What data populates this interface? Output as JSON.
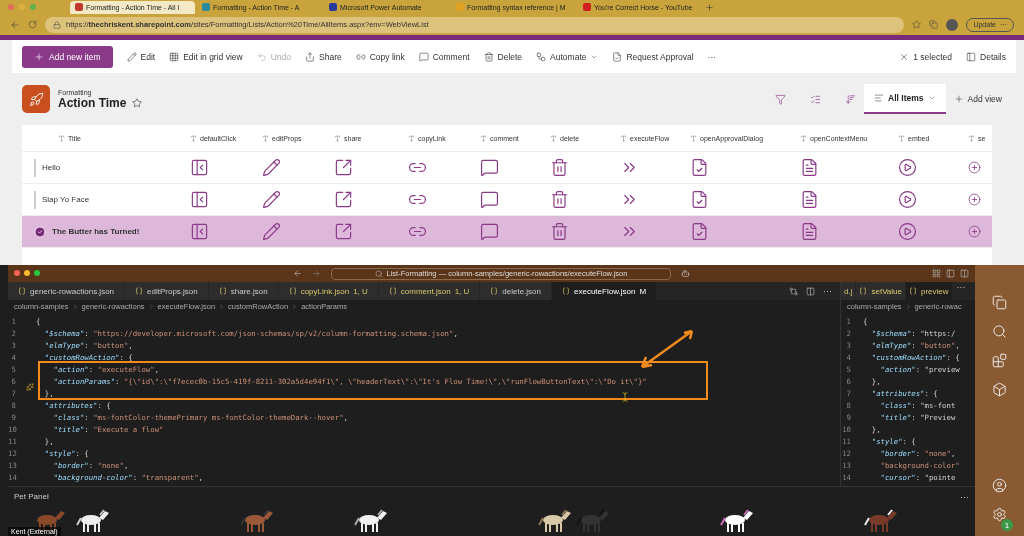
{
  "browser": {
    "tabs": [
      {
        "title": "Formatting - Action Time - All I",
        "selected": true
      },
      {
        "title": "Formatting - Action Time - A",
        "selected": false
      },
      {
        "title": "Microsoft Power Automate",
        "selected": false
      },
      {
        "title": "Formatting syntax reference | M",
        "selected": false
      },
      {
        "title": "You're Correct Horse - YouTube",
        "selected": false
      }
    ],
    "url": "https://**thechriskent.sharepoint.com**/sites/Formatting/Lists/Action%20Time/AllItems.aspx?env=WebViewList",
    "update_button": "Update",
    "update_more": "···"
  },
  "command_bar": {
    "primary": "Add new item",
    "items": [
      {
        "label": "Edit",
        "disabled": false
      },
      {
        "label": "Edit in grid view",
        "disabled": false
      },
      {
        "label": "Undo",
        "disabled": true
      },
      {
        "label": "Share",
        "disabled": false
      },
      {
        "label": "Copy link",
        "disabled": false
      },
      {
        "label": "Comment",
        "disabled": false
      },
      {
        "label": "Delete",
        "disabled": false
      },
      {
        "label": "Automate",
        "disabled": false
      },
      {
        "label": "Request Approval",
        "disabled": false
      }
    ],
    "more": "···",
    "selected_count": "1 selected",
    "details": "Details"
  },
  "list_header": {
    "site": "Formatting",
    "title": "Action Time",
    "views": [
      {
        "label": "All Items",
        "selected": true
      }
    ],
    "add_view": "Add view"
  },
  "table": {
    "columns": [
      "Title",
      "defaultClick",
      "editProps",
      "share",
      "copyLink",
      "comment",
      "delete",
      "executeFlow",
      "openApprovalDialog",
      "openContextMenu",
      "embed",
      "se"
    ],
    "rows": [
      {
        "title": "Hello",
        "selected": false
      },
      {
        "title": "Slap Yo Face",
        "selected": false
      },
      {
        "title": "The Butter has Turned!",
        "selected": true
      }
    ]
  },
  "editor": {
    "title": "List-Formatting — column-samples/generic-rowactions/executeFlow.json",
    "tabs": [
      {
        "label": "generic-rowactions.json",
        "untracked": false,
        "selected": false
      },
      {
        "label": "editProps.json",
        "untracked": false,
        "selected": false
      },
      {
        "label": "share.json",
        "untracked": false,
        "selected": false
      },
      {
        "label": "copyLink.json",
        "badge": "1, U",
        "untracked": true,
        "selected": false
      },
      {
        "label": "comment.json",
        "badge": "1, U",
        "untracked": true,
        "selected": false
      },
      {
        "label": "delete.json",
        "untracked": false,
        "selected": false
      },
      {
        "label": "executeFlow.json",
        "badge": "M",
        "untracked": false,
        "selected": true
      }
    ],
    "tab_more": "···",
    "breadcrumb": [
      "column-samples",
      "generic-rowactions",
      "executeFlow.json",
      "customRowAction",
      "actionParams"
    ],
    "lines": [
      {
        "n": "1",
        "text": "{"
      },
      {
        "n": "2",
        "text": "  \"$schema\": \"https://developer.microsoft.com/json-schemas/sp/v2/column-formatting.schema.json\","
      },
      {
        "n": "3",
        "text": "  \"elmType\": \"button\","
      },
      {
        "n": "4",
        "text": "  \"customRowAction\": {"
      },
      {
        "n": "5",
        "text": "    \"action\": \"executeFlow\","
      },
      {
        "n": "6",
        "text": "    \"actionParams\": \"{\\\"id\\\":\\\"f7ecec0b-15c5-419f-8211-302a5d4e94f1\\\", \\\"headerText\\\":\\\"It's Flow Time!\\\",\\\"runFlowButtonText\\\":\\\"Do it\\\"}\""
      },
      {
        "n": "7",
        "text": "  },"
      },
      {
        "n": "8",
        "text": "  \"attributes\": {"
      },
      {
        "n": "9",
        "text": "    \"class\": \"ms-fontColor-themePrimary ms-fontColor-themeDark--hover\","
      },
      {
        "n": "10",
        "text": "    \"title\": \"Execute a flow\""
      },
      {
        "n": "11",
        "text": "  },"
      },
      {
        "n": "12",
        "text": "  \"style\": {"
      },
      {
        "n": "13",
        "text": "    \"border\": \"none\","
      },
      {
        "n": "14",
        "text": "    \"background-color\": \"transparent\","
      }
    ]
  },
  "side_editor": {
    "tabs": [
      {
        "label": "d.j",
        "selected": false
      },
      {
        "label": "setValue",
        "selected": false
      },
      {
        "label": "preview",
        "selected": true
      }
    ],
    "tab_more": "···",
    "breadcrumb": [
      "column-samples",
      "generic-rowac"
    ],
    "lines": [
      {
        "n": "1",
        "text": "{"
      },
      {
        "n": "2",
        "text": "  \"$schema\": \"https:/"
      },
      {
        "n": "3",
        "text": "  \"elmType\": \"button\","
      },
      {
        "n": "4",
        "text": "  \"customRowAction\": {"
      },
      {
        "n": "5",
        "text": "    \"action\": \"preview"
      },
      {
        "n": "6",
        "text": "  },"
      },
      {
        "n": "7",
        "text": "  \"attributes\": {"
      },
      {
        "n": "8",
        "text": "    \"class\": \"ms-font"
      },
      {
        "n": "9",
        "text": "    \"title\": \"Preview"
      },
      {
        "n": "10",
        "text": "  },"
      },
      {
        "n": "11",
        "text": "  \"style\": {"
      },
      {
        "n": "12",
        "text": "    \"border\": \"none\","
      },
      {
        "n": "13",
        "text": "    \"background-color\""
      },
      {
        "n": "14",
        "text": "    \"cursor\": \"pointe"
      }
    ]
  },
  "panel": {
    "title": "Pet Panel",
    "more": "···"
  },
  "activity_badge": "1",
  "caller": "Kent (External)"
}
